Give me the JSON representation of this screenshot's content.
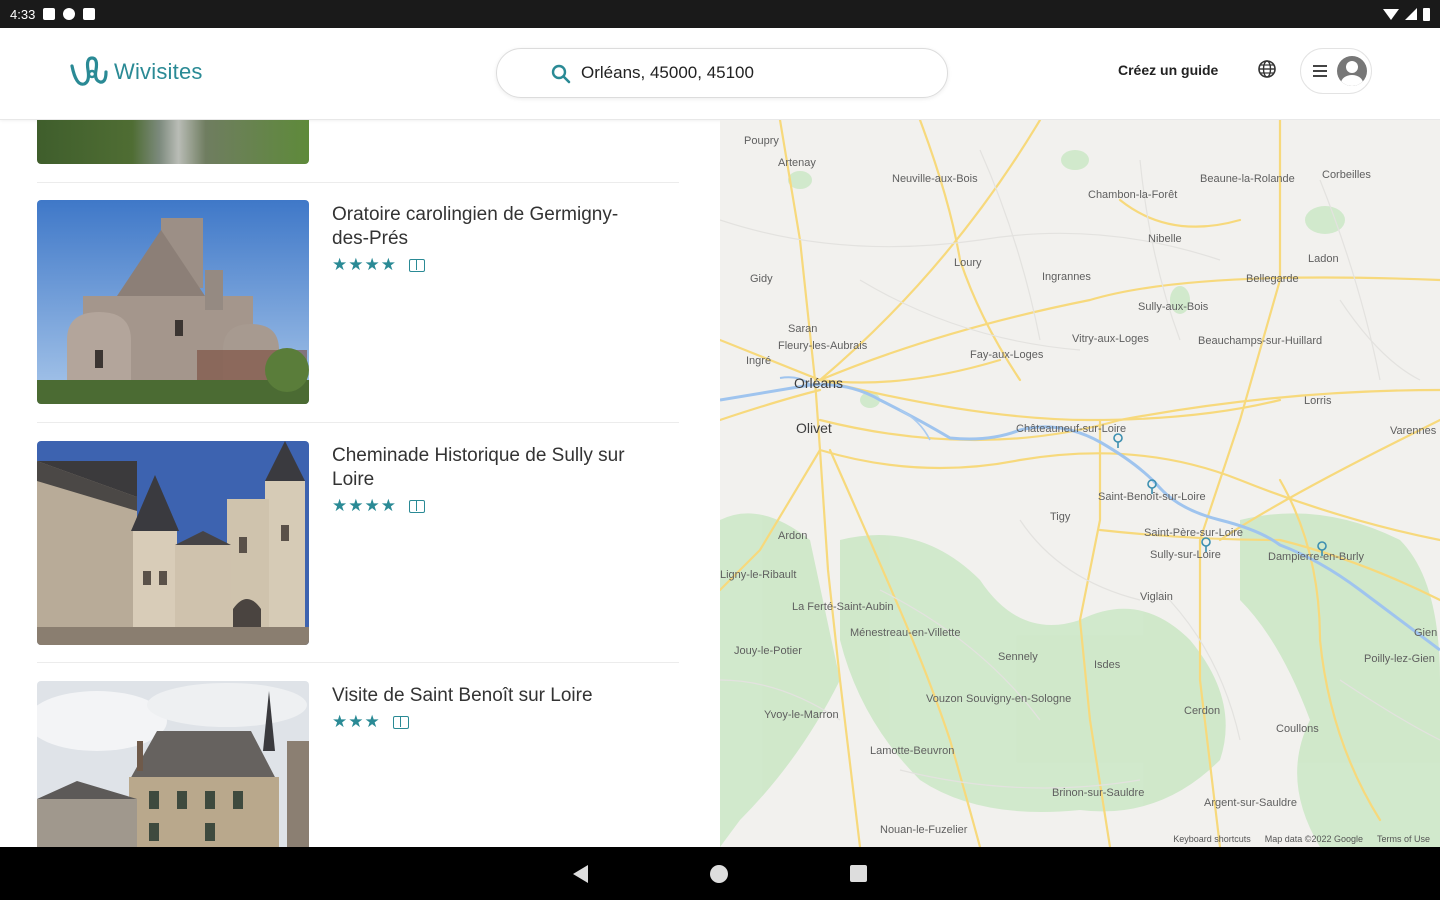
{
  "status_bar": {
    "time": "4:33"
  },
  "header": {
    "logo_text": "Wivisites",
    "search_value": "Orléans, 45000, 45100",
    "create_guide_label": "Créez un guide"
  },
  "results": [
    {
      "title": "Oratoire carolingien de Germigny-des-Prés",
      "stars": "★★★★"
    },
    {
      "title": "Cheminade Historique de Sully sur Loire",
      "stars": "★★★★"
    },
    {
      "title": "Visite de Saint Benoît sur Loire",
      "stars": "★★★"
    }
  ],
  "map": {
    "towns": [
      "Poupry",
      "Artenay",
      "Neuville-aux-Bois",
      "Chambon-la-Forêt",
      "Beaune-la-Rolande",
      "Corbeilles",
      "Nibelle",
      "Ladon",
      "Loury",
      "Ingrannes",
      "Bellegarde",
      "Sully-aux-Bois",
      "Gidy",
      "Saran",
      "Fleury-les-Aubrais",
      "Vitry-aux-Loges",
      "Fay-aux-Loges",
      "Beauchamps-sur-Huillard",
      "Ingré",
      "Orléans",
      "Lorris",
      "Olivet",
      "Châteauneuf-sur-Loire",
      "Varennes",
      "Saint-Benoît-sur-Loire",
      "Tigy",
      "Ardon",
      "Saint-Père-sur-Loire",
      "Sully-sur-Loire",
      "Dampierre-en-Burly",
      "Ligny-le-Ribault",
      "Viglain",
      "La Ferté-Saint-Aubin",
      "Ménestreau-en-Villette",
      "Gien",
      "Jouy-le-Potier",
      "Sennely",
      "Isdes",
      "Poilly-lez-Gien",
      "Vouzon",
      "Souvigny-en-Sologne",
      "Cerdon",
      "Yvoy-le-Marron",
      "Coullons",
      "Lamotte-Beuvron",
      "Brinon-sur-Sauldre",
      "Argent-sur-Sauldre",
      "Nouan-le-Fuzelier"
    ],
    "footer": {
      "shortcuts": "Keyboard shortcuts",
      "data": "Map data ©2022 Google",
      "terms": "Terms of Use"
    }
  }
}
